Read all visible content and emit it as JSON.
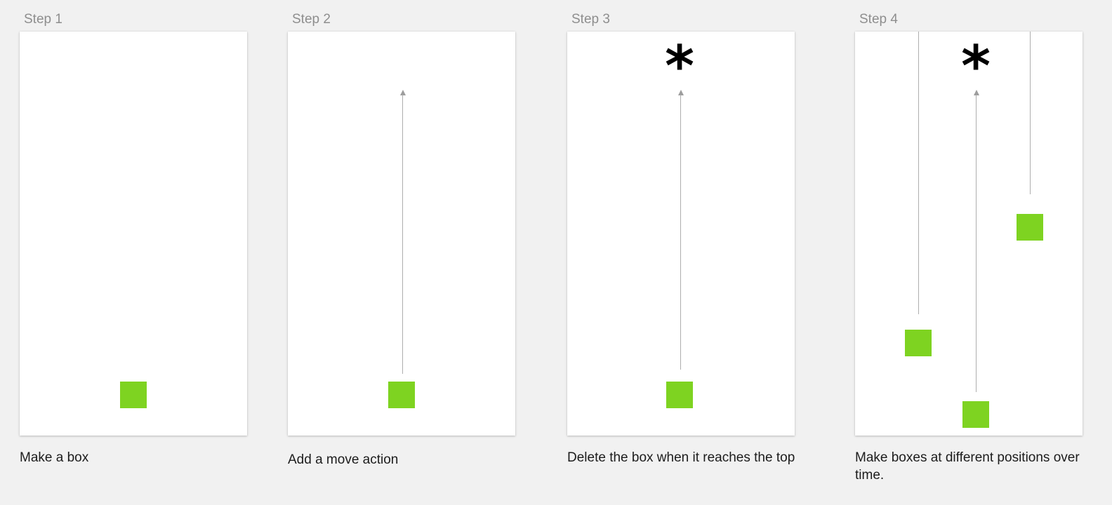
{
  "colors": {
    "background": "#f1f1f1",
    "card": "#ffffff",
    "box": "#7ed321",
    "line": "#aeaeae",
    "step_title": "#8e8e8e",
    "caption": "#1c1c1c"
  },
  "icons": {
    "delete_marker": "asterisk-icon",
    "move_arrow": "arrow-up-icon"
  },
  "steps": [
    {
      "title": "Step 1",
      "caption": "Make a box"
    },
    {
      "title": "Step 2",
      "caption": "Add a move action"
    },
    {
      "title": "Step 3",
      "caption": "Delete the box when it reaches the top",
      "marker": "*"
    },
    {
      "title": "Step 4",
      "caption": "Make boxes at different positions over time.",
      "marker": "*"
    }
  ]
}
